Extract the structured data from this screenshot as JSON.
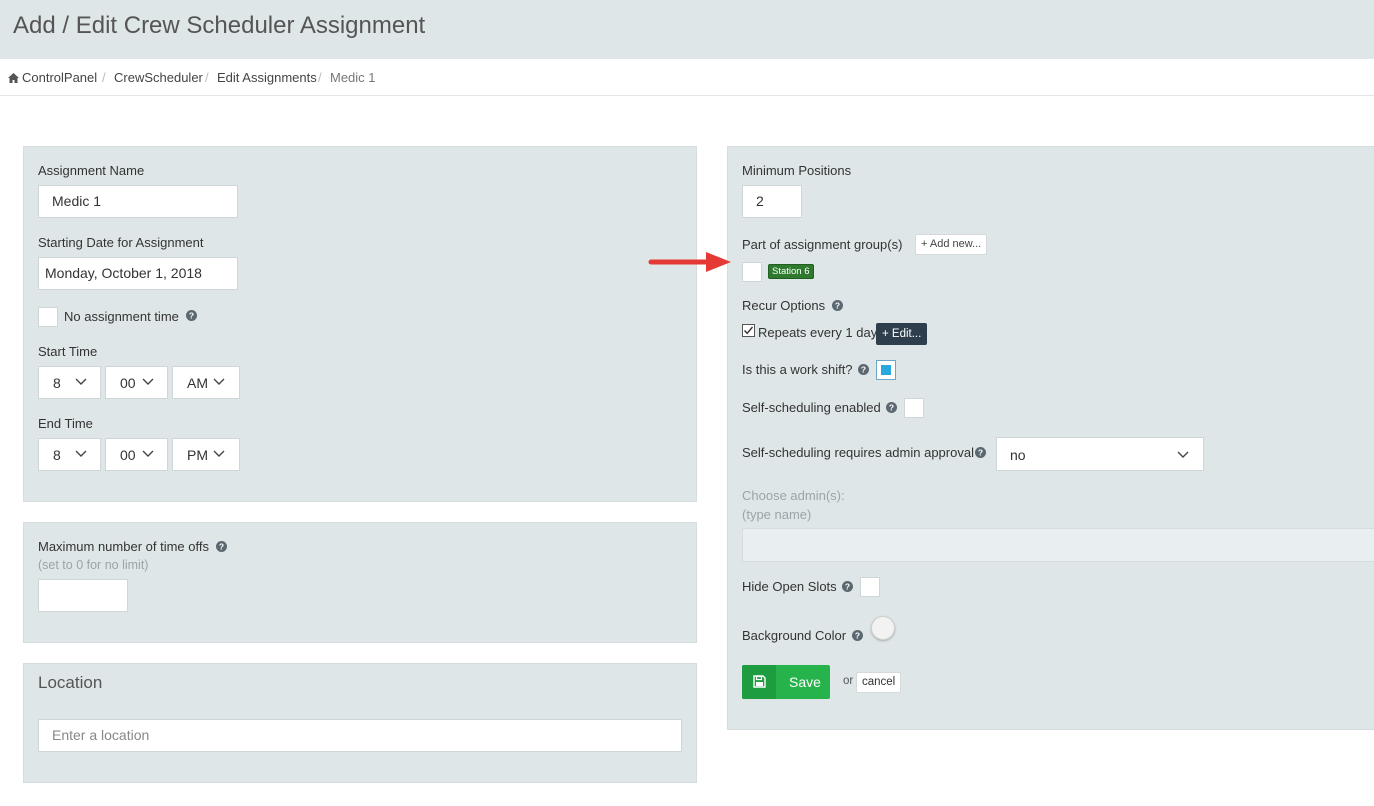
{
  "page": {
    "title": "Add / Edit Crew Scheduler Assignment"
  },
  "breadcrumb": [
    "ControlPanel",
    "CrewScheduler",
    "Edit Assignments",
    "Medic 1"
  ],
  "assignment": {
    "name_label": "Assignment Name",
    "name_value": "Medic 1",
    "start_date_label": "Starting Date for Assignment",
    "start_date_value": "Monday, October 1, 2018",
    "no_time_label": "No assignment time",
    "start_time_label": "Start Time",
    "start_time": {
      "hour": "8",
      "minute": "00",
      "ampm": "AM"
    },
    "end_time_label": "End Time",
    "end_time": {
      "hour": "8",
      "minute": "00",
      "ampm": "PM"
    }
  },
  "timeoffs": {
    "label": "Maximum number of time offs",
    "hint": "(set to 0 for no limit)",
    "value": ""
  },
  "location": {
    "title": "Location",
    "placeholder": "Enter a location"
  },
  "right": {
    "min_positions_label": "Minimum Positions",
    "min_positions_value": "2",
    "group_label": "Part of assignment group(s)",
    "add_new_label": "+ Add new...",
    "group_badge": "Station 6",
    "recur_label": "Recur Options",
    "recur_text": "Repeats every 1 days",
    "recur_edit": "+ Edit...",
    "work_shift_label": "Is this a work shift?",
    "self_sched_label": "Self-scheduling enabled",
    "approval_label": "Self-scheduling requires admin approval",
    "approval_value": "no",
    "choose_admin_label": "Choose admin(s):",
    "choose_admin_hint": "(type name)",
    "hide_slots_label": "Hide Open Slots",
    "bg_color_label": "Background Color",
    "save_label": "Save",
    "or_text": "or",
    "cancel_label": "cancel"
  },
  "colors": {
    "panel_bg": "#dfe6e8",
    "save_green": "#26b34b",
    "badge_green": "#2f7a2f",
    "work_shift_blue": "#29a8e0",
    "arrow_red": "#e53935"
  }
}
